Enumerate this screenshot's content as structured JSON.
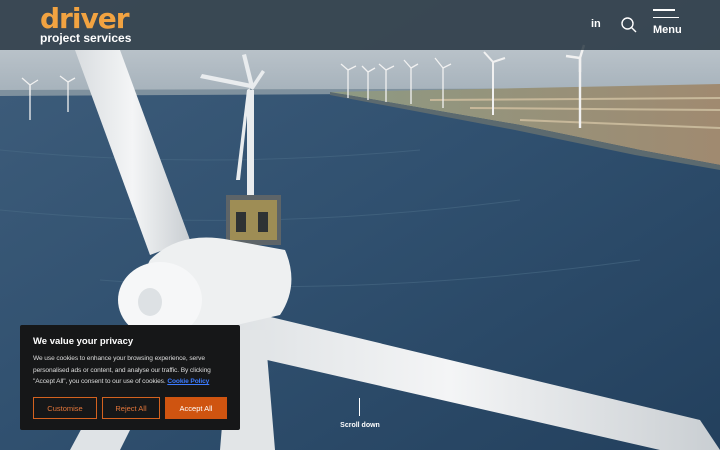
{
  "header": {
    "logo_word": "driver",
    "logo_sub": "project services",
    "linkedin_label": "in",
    "menu_label": "Menu",
    "icons": [
      "linkedin-icon",
      "search-icon",
      "hamburger-icon"
    ],
    "logo_color": "#f2a341"
  },
  "hero": {
    "scroll_label": "Scroll down",
    "image_subject": "aerial-wind-turbines"
  },
  "cookie": {
    "title": "We value your privacy",
    "text": "We use cookies to enhance your browsing experience, serve personalised ads or content, and analyse our traffic. By clicking \"Accept All\", you consent to our use of cookies.",
    "link_label": "Cookie Policy",
    "customise_label": "Customise",
    "reject_label": "Reject All",
    "accept_label": "Accept All",
    "accent_color": "#cf5410"
  }
}
